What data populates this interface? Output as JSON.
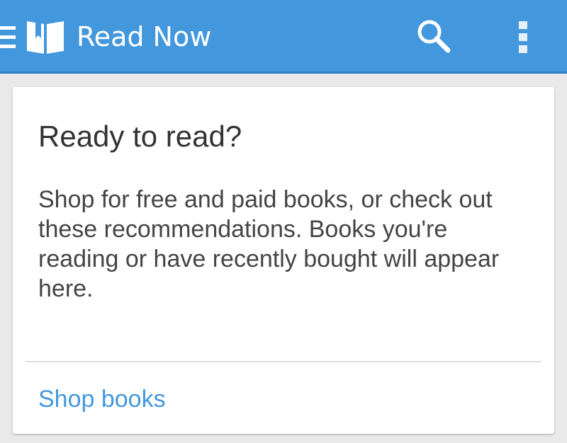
{
  "app_bar": {
    "title": "Read Now",
    "background_color": "#4398dd",
    "icons": {
      "menu": "hamburger-menu-icon",
      "logo": "book-logo-icon",
      "search": "search-icon",
      "overflow": "overflow-menu-icon"
    }
  },
  "card": {
    "title": "Ready to read?",
    "body": "Shop for free and paid books, or check out these recommendations. Books you're reading or have recently bought will appear here.",
    "action_label": "Shop books",
    "action_color": "#4398dd"
  }
}
